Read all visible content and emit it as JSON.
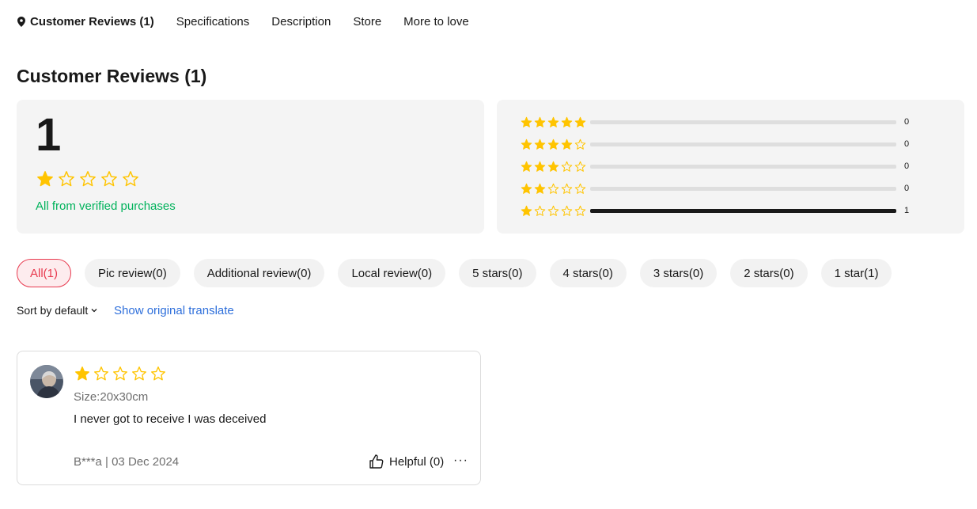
{
  "colors": {
    "star": "#ffc400",
    "accent": "#e83a4f",
    "verified": "#00b25b",
    "link": "#2e6fdb"
  },
  "tabs": [
    {
      "label": "Customer Reviews (1)",
      "active": true,
      "icon": "location-pin-icon"
    },
    {
      "label": "Specifications"
    },
    {
      "label": "Description"
    },
    {
      "label": "Store"
    },
    {
      "label": "More to love"
    }
  ],
  "section": {
    "title": "Customer Reviews (1)"
  },
  "summary": {
    "rating": "1",
    "stars_filled": 1,
    "stars_total": 5,
    "verified_text": "All from verified purchases"
  },
  "distribution": [
    {
      "stars": 5,
      "count": "0",
      "fraction": 0
    },
    {
      "stars": 4,
      "count": "0",
      "fraction": 0
    },
    {
      "stars": 3,
      "count": "0",
      "fraction": 0
    },
    {
      "stars": 2,
      "count": "0",
      "fraction": 0
    },
    {
      "stars": 1,
      "count": "1",
      "fraction": 1
    }
  ],
  "filters": [
    {
      "label": "All(1)",
      "active": true
    },
    {
      "label": "Pic review(0)"
    },
    {
      "label": "Additional review(0)"
    },
    {
      "label": "Local review(0)"
    },
    {
      "label": "5 stars(0)"
    },
    {
      "label": "4 stars(0)"
    },
    {
      "label": "3 stars(0)"
    },
    {
      "label": "2 stars(0)"
    },
    {
      "label": "1 star(1)"
    }
  ],
  "sort": {
    "label": "Sort by default"
  },
  "translate": {
    "label": "Show original translate"
  },
  "review": {
    "stars_filled": 1,
    "size": "Size:20x30cm",
    "text": "I never got to receive I was deceived",
    "meta": "B***a | 03 Dec 2024",
    "helpful": "Helpful (0)",
    "more": "···"
  }
}
